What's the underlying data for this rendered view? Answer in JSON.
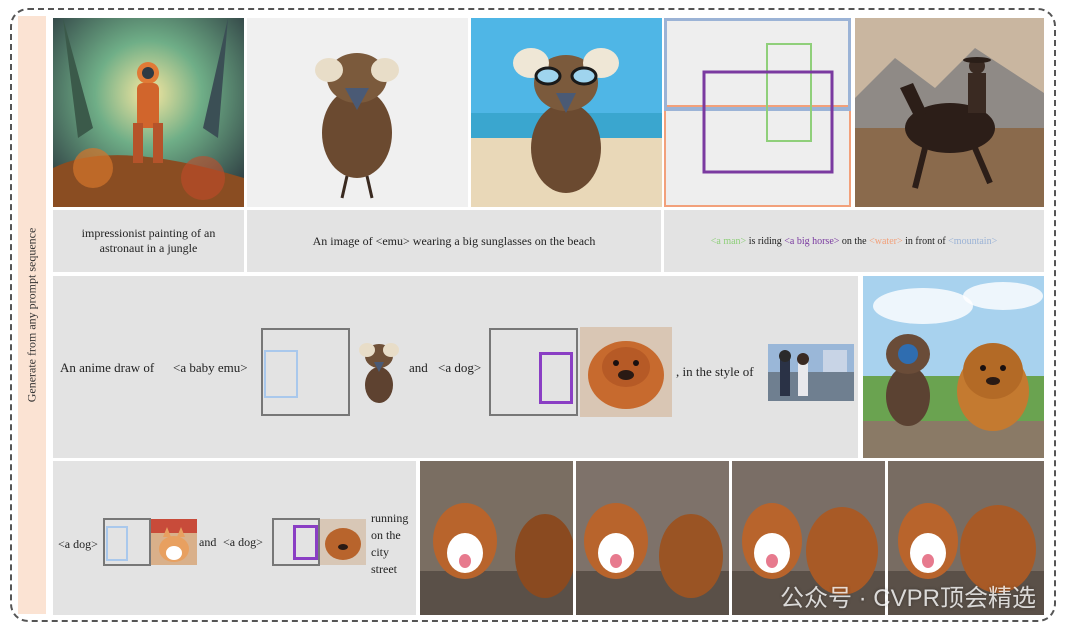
{
  "side_label": "Generate from any prompt sequence",
  "row1": {
    "caption_astronaut": "impressionist painting of an astronaut in a jungle",
    "caption_emu": "An image of <emu> wearing a big sunglasses on the beach",
    "caption_man": {
      "t1": "<a man>",
      "t2": " is riding ",
      "t3": "<a big  horse>",
      "t4": " on the ",
      "t5": "<water>",
      "t6": " in front of ",
      "t7": "<mountain>"
    }
  },
  "row2": {
    "t1": "An anime draw of",
    "t2": "<a baby emu>",
    "t3": "and",
    "t4": "<a dog>",
    "t5": ", in the style of"
  },
  "row3": {
    "t1": "<a dog>",
    "t2": "and",
    "t3": "<a dog>",
    "t4": "running on the city street"
  },
  "watermark": "公众号 · CVPR顶会精选"
}
